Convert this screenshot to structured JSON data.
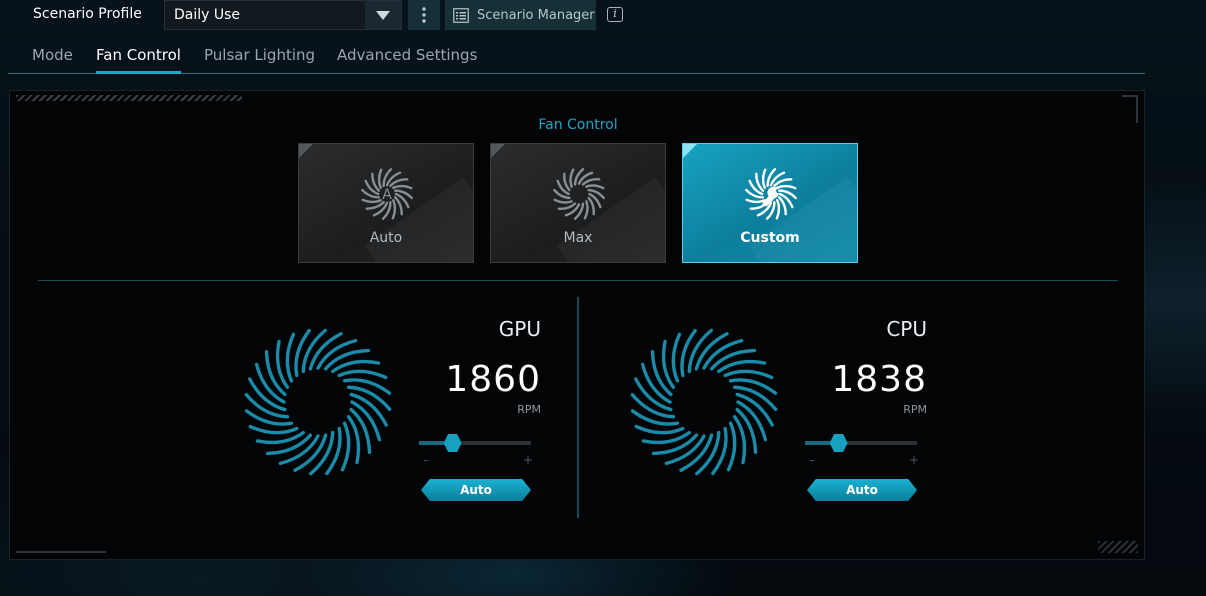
{
  "topbar": {
    "profile_label": "Scenario Profile",
    "profile_value": "Daily Use",
    "scenario_manager_label": "Scenario Manager",
    "info_glyph": "i"
  },
  "tabs": [
    {
      "label": "Mode",
      "active": false
    },
    {
      "label": "Fan Control",
      "active": true
    },
    {
      "label": "Pulsar Lighting",
      "active": false
    },
    {
      "label": "Advanced Settings",
      "active": false
    }
  ],
  "fan_control": {
    "title": "Fan Control",
    "modes": [
      {
        "label": "Auto",
        "icon": "fan-auto-icon",
        "selected": false
      },
      {
        "label": "Max",
        "icon": "fan-max-icon",
        "selected": false
      },
      {
        "label": "Custom",
        "icon": "fan-custom-icon",
        "selected": true
      }
    ],
    "fans": [
      {
        "name": "GPU",
        "rpm": "1860",
        "unit": "RPM",
        "level": 0.3,
        "minus": "–",
        "plus": "+",
        "button": "Auto"
      },
      {
        "name": "CPU",
        "rpm": "1838",
        "unit": "RPM",
        "level": 0.3,
        "minus": "–",
        "plus": "+",
        "button": "Auto"
      }
    ]
  },
  "colors": {
    "accent": "#19a8c8",
    "fan_blade": "#1a8ba8",
    "selected_card": "#0f8aa8",
    "panel_bg": "#020405"
  }
}
